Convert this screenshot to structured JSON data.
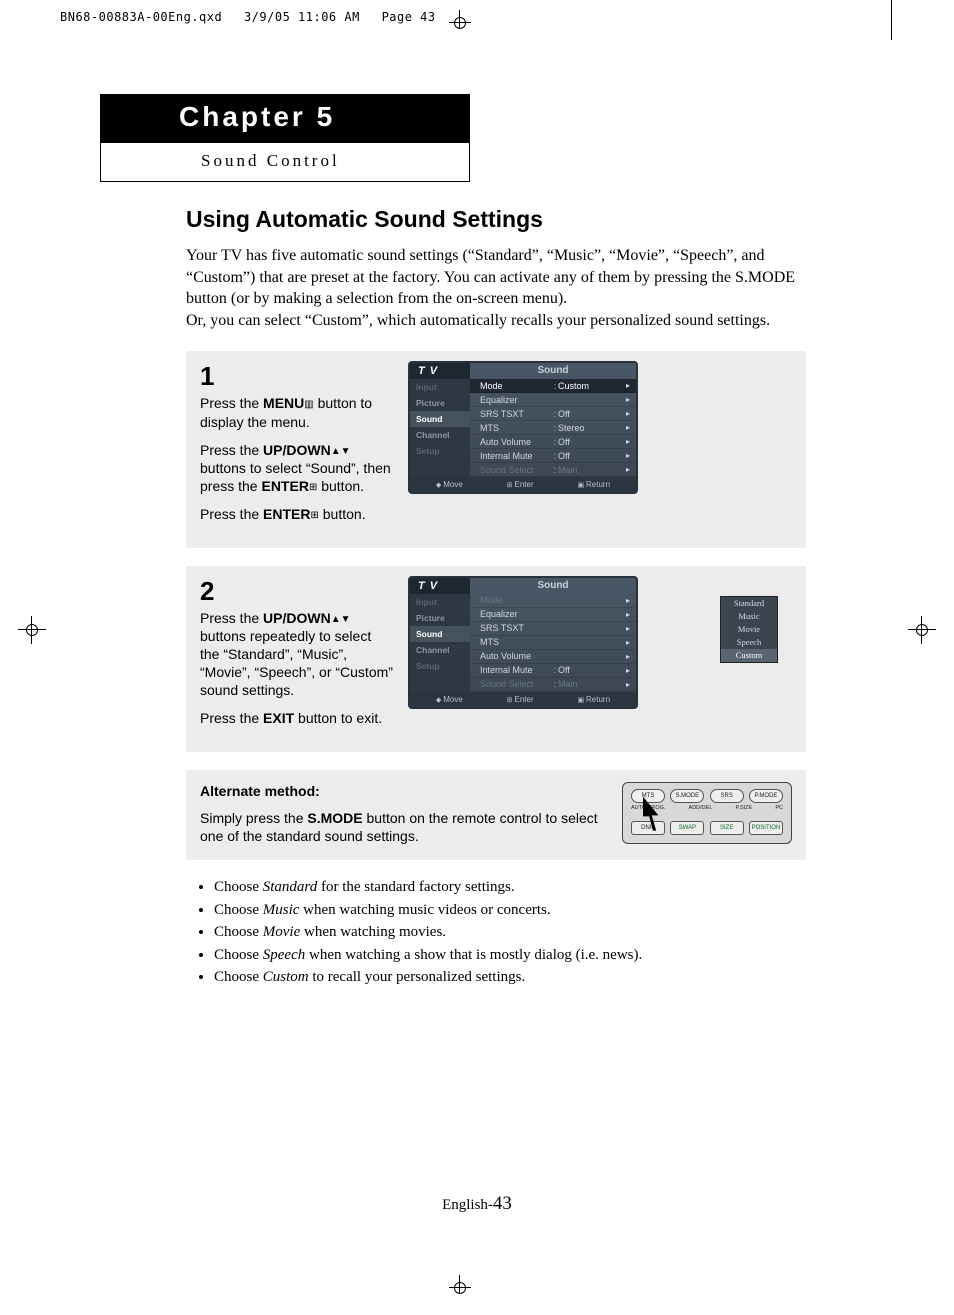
{
  "print_header": {
    "file": "BN68-00883A-00Eng.qxd",
    "date": "3/9/05 11:06 AM",
    "page": "Page 43"
  },
  "chapter": {
    "label": "Chapter 5",
    "subtitle": "Sound Control"
  },
  "section_title": "Using Automatic Sound Settings",
  "intro": "Your TV has five automatic sound settings (“Standard”, “Music”, “Movie”, “Speech”, and “Custom”) that are preset at the factory. You can activate any of them by pressing the S.MODE button (or by making a selection from the on-screen menu).\nOr, you can select “Custom”, which automatically recalls your personalized sound settings.",
  "steps": [
    {
      "num": "1",
      "paras": [
        "Press the <b>MENU</b><span class='step-icon'>▥</span> button to display the menu.",
        "Press the <b>UP/DOWN</b><span class='step-icon'>▲▼</span> buttons to select “Sound”, then press the <b>ENTER</b><span class='step-icon'>⊞</span> button.",
        "Press the <b>ENTER</b><span class='step-icon'>⊞</span> button."
      ],
      "osd": {
        "title": "Sound",
        "tabs": [
          "Input",
          "Picture",
          "Sound",
          "Channel",
          "Setup"
        ],
        "active_tab": 2,
        "rows": [
          {
            "lbl": "Mode",
            "val": "Custom",
            "sel": true
          },
          {
            "lbl": "Equalizer",
            "val": ""
          },
          {
            "lbl": "SRS TSXT",
            "val": "Off"
          },
          {
            "lbl": "MTS",
            "val": "Stereo"
          },
          {
            "lbl": "Auto Volume",
            "val": "Off"
          },
          {
            "lbl": "Internal Mute",
            "val": "Off"
          },
          {
            "lbl": "Sound Select",
            "val": "Main",
            "dim": true
          }
        ],
        "foot": [
          "Move",
          "Enter",
          "Return"
        ]
      }
    },
    {
      "num": "2",
      "paras": [
        "Press the <b>UP/DOWN</b><span class='step-icon'>▲▼</span> buttons repeatedly to select the “Standard”, “Music”, “Movie”, “Speech”, or “Custom” sound settings.",
        "Press the <b>EXIT</b> button to exit."
      ],
      "osd": {
        "title": "Sound",
        "tabs": [
          "Input",
          "Picture",
          "Sound",
          "Channel",
          "Setup"
        ],
        "active_tab": 2,
        "rows": [
          {
            "lbl": "Mode",
            "val": "",
            "dim": true
          },
          {
            "lbl": "Equalizer",
            "val": ""
          },
          {
            "lbl": "SRS TSXT",
            "val": ""
          },
          {
            "lbl": "MTS",
            "val": ""
          },
          {
            "lbl": "Auto Volume",
            "val": ""
          },
          {
            "lbl": "Internal Mute",
            "val": "Off"
          },
          {
            "lbl": "Sound Select",
            "val": "Main",
            "dim": true
          }
        ],
        "options": [
          "Standard",
          "Music",
          "Movie",
          "Speech",
          "Custom"
        ],
        "option_sel": 4,
        "foot": [
          "Move",
          "Enter",
          "Return"
        ]
      }
    }
  ],
  "alternate": {
    "heading": "Alternate method:",
    "body": "Simply press the <b>S.MODE</b> button on the remote control to select one of the standard sound settings.",
    "remote_top": [
      "MTS",
      "S.MODE",
      "SRS",
      "P.MODE"
    ],
    "remote_mid": [
      "AUTO PROG.",
      "ADD/DEL",
      "P.SIZE",
      "PC"
    ],
    "remote_bot": [
      "DNIe",
      "SWAP",
      "SIZE",
      "POSITION"
    ]
  },
  "bullets": [
    "Choose <em>Standard</em> for the standard factory settings.",
    "Choose <em>Music</em> when watching music videos or concerts.",
    "Choose <em>Movie</em> when watching movies.",
    "Choose <em>Speech</em> when watching a show that is mostly dialog (i.e. news).",
    "Choose <em>Custom</em> to recall your personalized settings."
  ],
  "page_footer": {
    "lang": "English-",
    "num": "43"
  }
}
